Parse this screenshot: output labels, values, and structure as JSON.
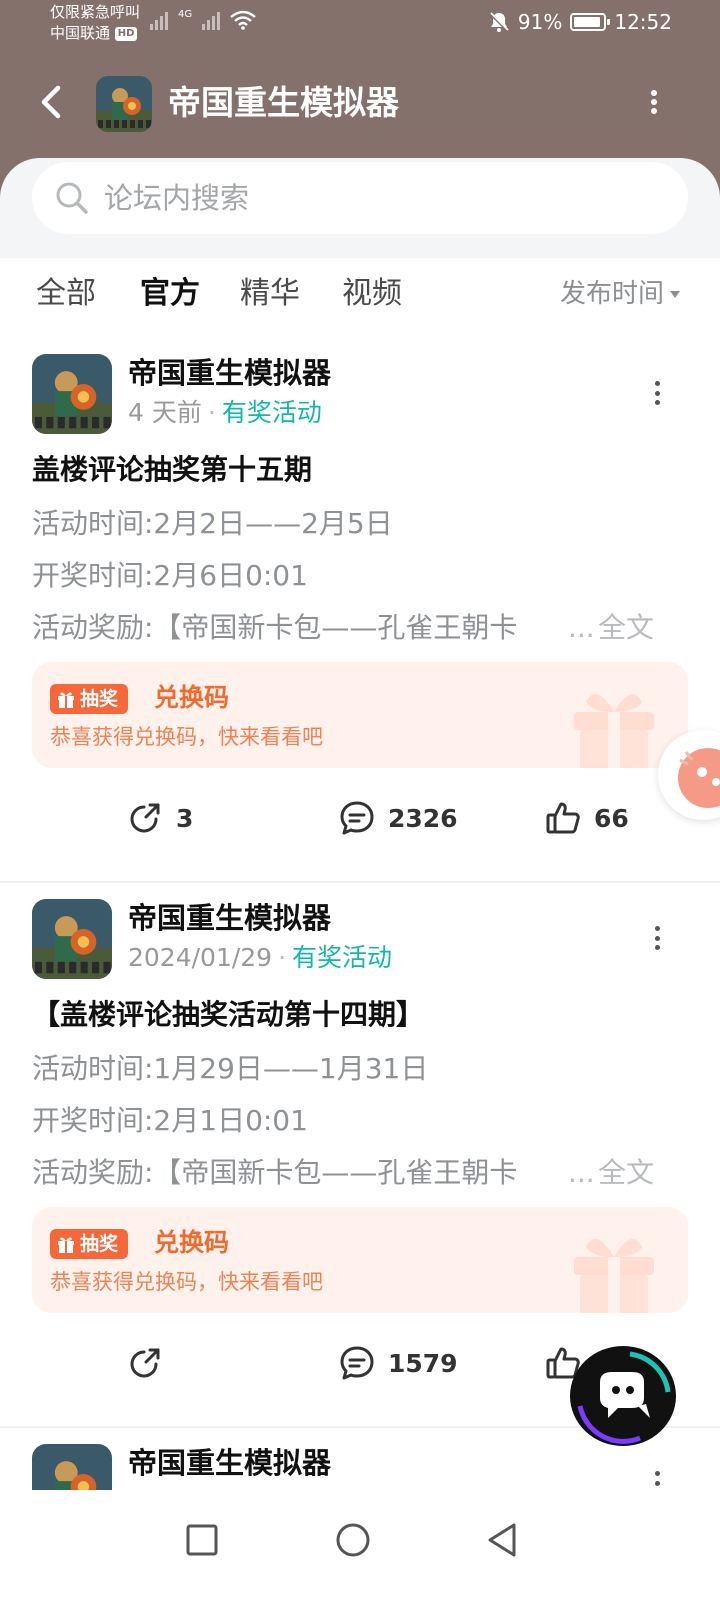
{
  "status_bar": {
    "carrier_line1": "仅限紧急呼叫",
    "carrier_line2": "中国联通",
    "hd": "HD",
    "network": "4G",
    "battery": "91%",
    "time": "12:52"
  },
  "header": {
    "title": "帝国重生模拟器",
    "back_icon": "chevron-left-icon",
    "more_icon": "more-vertical-icon"
  },
  "search": {
    "placeholder": "论坛内搜索"
  },
  "tabs": [
    {
      "label": "全部",
      "active": false
    },
    {
      "label": "官方",
      "active": true
    },
    {
      "label": "精华",
      "active": false
    },
    {
      "label": "视频",
      "active": false
    }
  ],
  "sort": {
    "label": "发布时间"
  },
  "posts": [
    {
      "author": "帝国重生模拟器",
      "time": "4 天前",
      "tag": "有奖活动",
      "title": "盖楼评论抽奖第十五期",
      "line1": "活动时间:2月2日——2月5日",
      "line2": "开奖时间:2月6日0:01",
      "line3": "活动奖励:【帝国新卡包——孔雀王朝卡",
      "ellipsis": "...",
      "fulltext": "全文",
      "promo": {
        "badge": "抽奖",
        "title": "兑换码",
        "subtitle": "恭喜获得兑换码，快来看看吧"
      },
      "shares": "3",
      "comments": "2326",
      "likes": "66"
    },
    {
      "author": "帝国重生模拟器",
      "time": "2024/01/29",
      "tag": "有奖活动",
      "title": "【盖楼评论抽奖活动第十四期】",
      "line1": "活动时间:1月29日——1月31日",
      "line2": "开奖时间:2月1日0:01",
      "line3": "活动奖励:【帝国新卡包——孔雀王朝卡",
      "ellipsis": "...",
      "fulltext": "全文",
      "promo": {
        "badge": "抽奖",
        "title": "兑换码",
        "subtitle": "恭喜获得兑换码，快来看看吧"
      },
      "shares": "",
      "comments": "1579",
      "likes": ""
    },
    {
      "author": "帝国重生模拟器"
    }
  ],
  "colors": {
    "header_bg": "#85716c",
    "accent": "#14b8a6",
    "promo_bg": "#fff1ec",
    "promo_orange": "#f26a2e"
  }
}
